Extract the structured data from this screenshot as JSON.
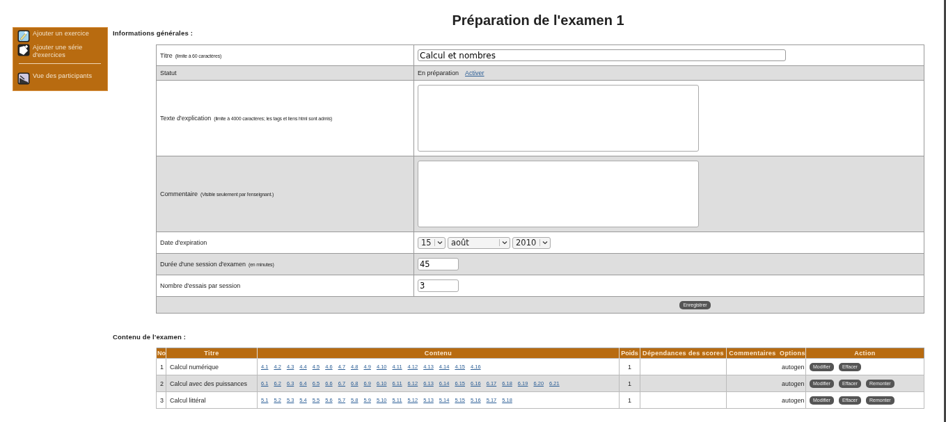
{
  "title": "Préparation de l'examen 1",
  "sidebar": {
    "items": [
      {
        "label": "Ajouter un exercice",
        "separator_before": false
      },
      {
        "label": "Ajouter une série d'exercices",
        "separator_before": false
      },
      {
        "label": "Vue des participants",
        "separator_before": true
      }
    ]
  },
  "general": {
    "heading": "Informations générales :",
    "rows": [
      {
        "kind": "text",
        "label": "Titre",
        "note": "(limite à 60 caractères)",
        "value": "Calcul et nombres"
      },
      {
        "kind": "status",
        "label": "Statut",
        "status": "En préparation",
        "link": "Activer"
      },
      {
        "kind": "textarea",
        "label": "Texte d'explication",
        "note": "(limite à 4000 caractères; les tags et liens html sont admis)"
      },
      {
        "kind": "textarea",
        "label": "Commentaire",
        "note": "(Visible seulement par l'enseignant.)"
      },
      {
        "kind": "date",
        "label": "Date d'expiration",
        "day": "15",
        "month": "août",
        "year": "2010"
      },
      {
        "kind": "number",
        "label": "Durée d'une session d'examen",
        "note": "(en minutes)",
        "value": "45"
      },
      {
        "kind": "number",
        "label": "Nombre d'essais par session",
        "value": "3"
      }
    ],
    "save": "Enregistrer"
  },
  "content": {
    "heading": "Contenu de l'examen :",
    "columns": [
      "No",
      "Titre",
      "Contenu",
      "Poids",
      "Dépendances des scores",
      "Commentaires",
      "Options",
      "Action"
    ],
    "rows": [
      {
        "no": "1",
        "title": "Calcul numérique",
        "links": [
          "4.1",
          "4.2",
          "4.3",
          "4.4",
          "4.5",
          "4.6",
          "4.7",
          "4.8",
          "4.9",
          "4.10",
          "4.11",
          "4.12",
          "4.13",
          "4.14",
          "4.15",
          "4.16"
        ],
        "weight": "1",
        "options": "autogen",
        "actions": [
          "Modifier",
          "Effacer"
        ]
      },
      {
        "no": "2",
        "title": "Calcul avec des puissances",
        "links": [
          "6.1",
          "6.2",
          "6.3",
          "6.4",
          "6.5",
          "6.6",
          "6.7",
          "6.8",
          "6.9",
          "6.10",
          "6.11",
          "6.12",
          "6.13",
          "6.14",
          "6.15",
          "6.16",
          "6.17",
          "6.18",
          "6.19",
          "6.20",
          "6.21"
        ],
        "weight": "1",
        "options": "autogen",
        "actions": [
          "Modifier",
          "Effacer",
          "Remonter"
        ]
      },
      {
        "no": "3",
        "title": "Calcul littéral",
        "links": [
          "5.1",
          "5.2",
          "5.3",
          "5.4",
          "5.5",
          "5.6",
          "5.7",
          "5.8",
          "5.9",
          "5.10",
          "5.11",
          "5.12",
          "5.13",
          "5.14",
          "5.15",
          "5.16",
          "5.17",
          "5.18"
        ],
        "weight": "1",
        "options": "autogen",
        "actions": [
          "Modifier",
          "Effacer",
          "Remonter"
        ]
      }
    ]
  }
}
